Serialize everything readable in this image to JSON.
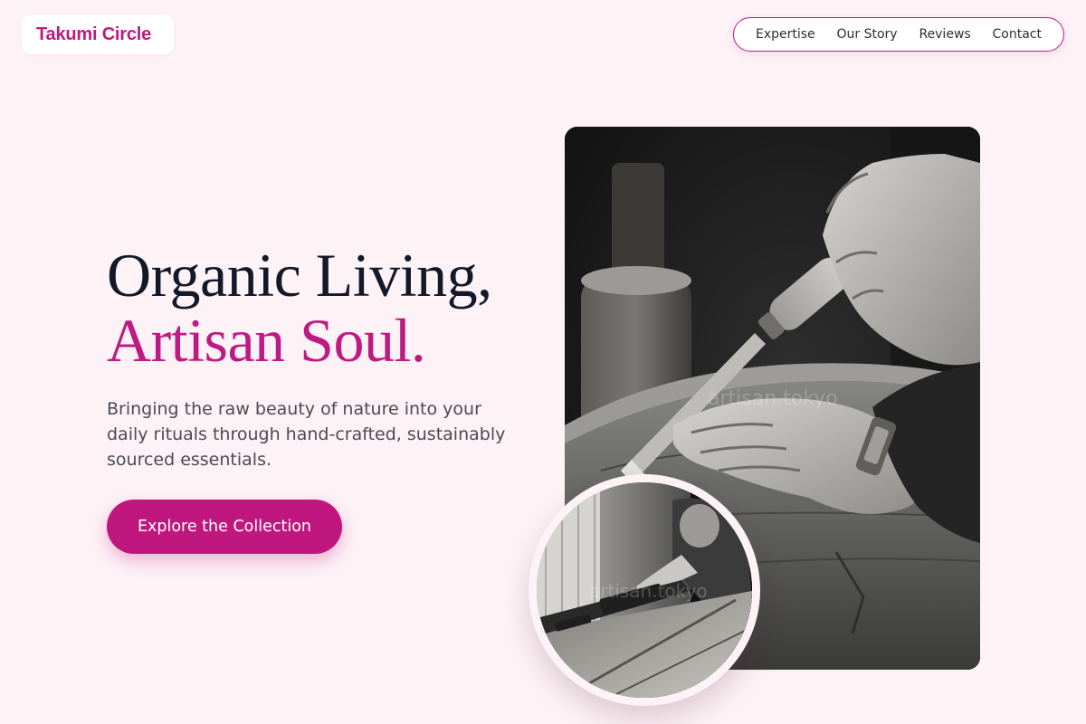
{
  "brand": {
    "name": "Takumi Circle",
    "accent_color": "#be1a83"
  },
  "nav": {
    "items": [
      {
        "label": "Expertise"
      },
      {
        "label": "Our Story"
      },
      {
        "label": "Reviews"
      },
      {
        "label": "Contact"
      }
    ]
  },
  "hero": {
    "headline_line1": "Organic Living,",
    "headline_line2": "Artisan Soul.",
    "subtitle": "Bringing the raw beauty of nature into your daily rituals through hand-crafted, sustainably sourced essentials.",
    "cta_label": "Explore the Collection"
  },
  "images": {
    "main_watermark": "artisan.tokyo",
    "inset_watermark": "artisan.tokyo"
  },
  "colors": {
    "background": "#fdf2f6",
    "headline_dark": "#141929",
    "accent": "#be1a83",
    "body_text": "#4a4b55"
  }
}
